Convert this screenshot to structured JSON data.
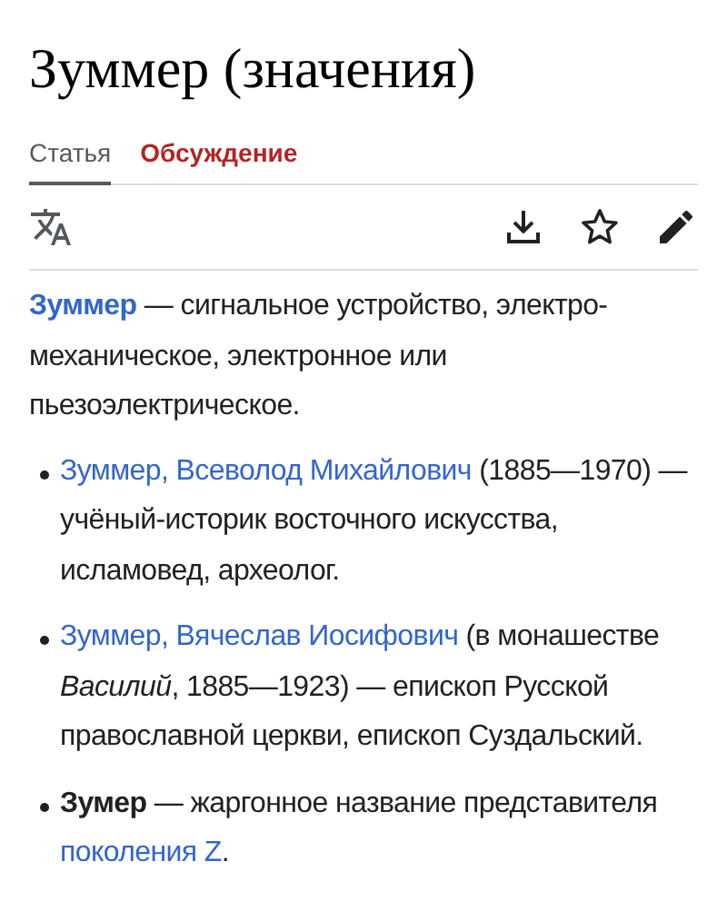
{
  "title": "Зуммер (значения)",
  "tabs": [
    {
      "label": "Статья",
      "selected": true,
      "color": "#54595d"
    },
    {
      "label": "Обсуждение",
      "selected": false,
      "color": "#b32424"
    }
  ],
  "intro": [
    {
      "kind": "bold-link",
      "text": "Зуммер"
    },
    {
      "kind": "text",
      "text": " — сигнальное устройство, электро-механическое, электронное или пьезоэлектрическое."
    }
  ],
  "items": [
    [
      {
        "kind": "link",
        "text": "Зуммер, Всеволод Михайлович"
      },
      {
        "kind": "text",
        "text": " (1885—1970) — учёный-историк восточного искусства, исламовед, археолог."
      }
    ],
    [
      {
        "kind": "link",
        "text": "Зуммер, Вячеслав Иосифович"
      },
      {
        "kind": "text",
        "text": " (в монашестве "
      },
      {
        "kind": "italic",
        "text": "Василий"
      },
      {
        "kind": "text",
        "text": ", 1885—1923) — епископ Русской православной церкви, епископ Суздальский."
      }
    ],
    [
      {
        "kind": "bold",
        "text": "Зумер"
      },
      {
        "kind": "text",
        "text": " — жаргонное название представителя "
      },
      {
        "kind": "link",
        "text": "поколения Z"
      },
      {
        "kind": "text",
        "text": "."
      }
    ]
  ]
}
